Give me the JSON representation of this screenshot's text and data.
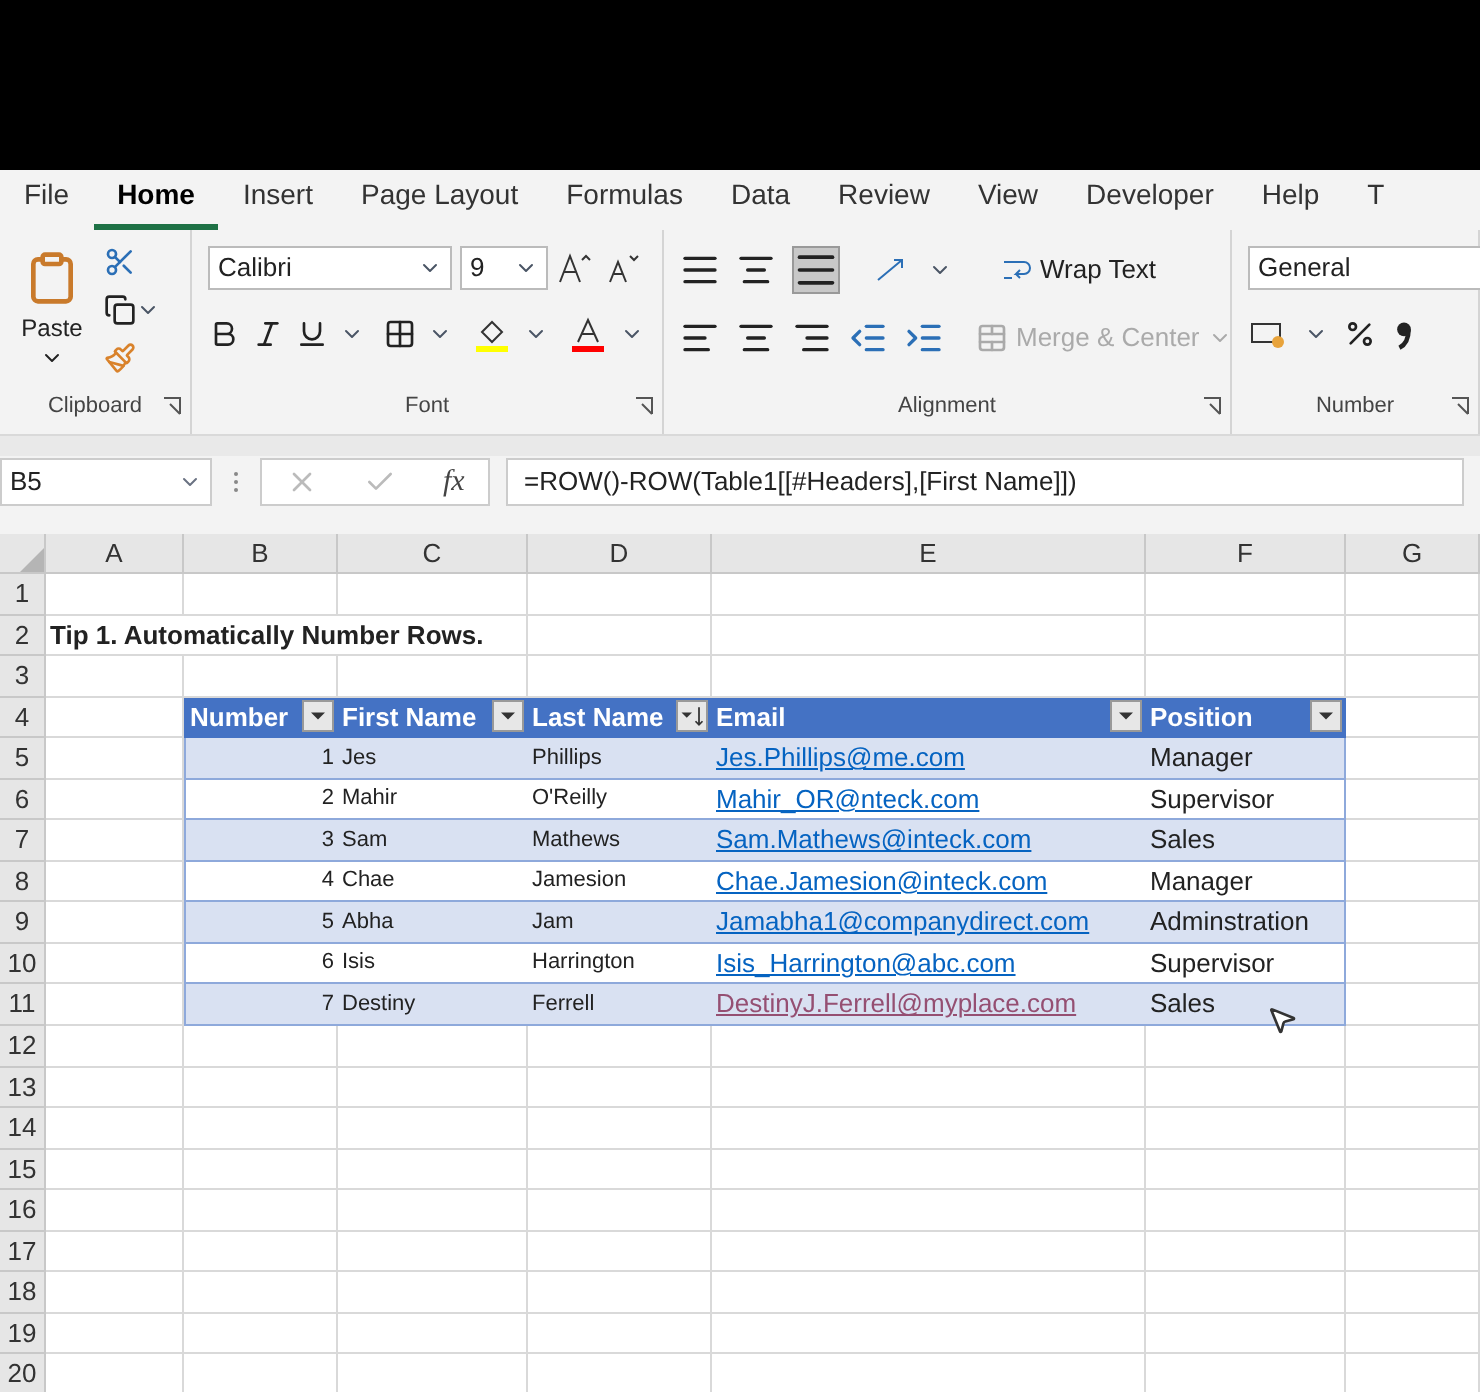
{
  "menu_tabs": [
    {
      "label": "File",
      "selected": false
    },
    {
      "label": "Home",
      "selected": true
    },
    {
      "label": "Insert",
      "selected": false
    },
    {
      "label": "Page Layout",
      "selected": false
    },
    {
      "label": "Formulas",
      "selected": false
    },
    {
      "label": "Data",
      "selected": false
    },
    {
      "label": "Review",
      "selected": false
    },
    {
      "label": "View",
      "selected": false
    },
    {
      "label": "Developer",
      "selected": false
    },
    {
      "label": "Help",
      "selected": false
    },
    {
      "label": "T",
      "selected": false
    }
  ],
  "ribbon": {
    "clipboard": {
      "paste": "Paste",
      "group_label": "Clipboard"
    },
    "font": {
      "font_name": "Calibri",
      "font_size": "9",
      "group_label": "Font"
    },
    "alignment": {
      "wrap_text": "Wrap Text",
      "merge_center": "Merge & Center",
      "merge_disabled": true,
      "group_label": "Alignment"
    },
    "number": {
      "format": "General",
      "group_label": "Number"
    }
  },
  "formula_bar": {
    "name_box": "B5",
    "function_label": "fx",
    "formula": "=ROW()-ROW(Table1[[#Headers],[First Name]])"
  },
  "sheet": {
    "columns": [
      "A",
      "B",
      "C",
      "D",
      "E",
      "F",
      "G"
    ],
    "row_numbers": [
      "1",
      "2",
      "3",
      "4",
      "5",
      "6",
      "7",
      "8",
      "9",
      "10",
      "11",
      "12",
      "13",
      "14",
      "15",
      "16",
      "17",
      "18",
      "19",
      "20"
    ],
    "title": "Tip 1.  Automatically Number Rows.",
    "table": {
      "headers": [
        {
          "label": "Number",
          "kind": "filter"
        },
        {
          "label": "First Name",
          "kind": "filter"
        },
        {
          "label": "Last Name",
          "kind": "sorted"
        },
        {
          "label": "Email",
          "kind": "filter"
        },
        {
          "label": "Position",
          "kind": "filter"
        }
      ],
      "rows": [
        {
          "number": "1",
          "first": "Jes",
          "last": "Phillips",
          "email": "Jes.Phillips@me.com",
          "visited": false,
          "position": "Manager"
        },
        {
          "number": "2",
          "first": "Mahir",
          "last": "O'Reilly",
          "email": "Mahir_OR@nteck.com",
          "visited": false,
          "position": "Supervisor"
        },
        {
          "number": "3",
          "first": "Sam",
          "last": "Mathews",
          "email": "Sam.Mathews@inteck.com",
          "visited": false,
          "position": "Sales"
        },
        {
          "number": "4",
          "first": "Chae",
          "last": "Jamesion",
          "email": "Chae.Jamesion@inteck.com",
          "visited": false,
          "position": "Manager"
        },
        {
          "number": "5",
          "first": "Abha",
          "last": "Jam",
          "email": "Jamabha1@companydirect.com",
          "visited": false,
          "position": "Adminstration"
        },
        {
          "number": "6",
          "first": "Isis",
          "last": "Harrington",
          "email": "Isis_Harrington@abc.com",
          "visited": false,
          "position": "Supervisor"
        },
        {
          "number": "7",
          "first": "Destiny",
          "last": "Ferrell",
          "email": "DestinyJ.Ferrell@myplace.com",
          "visited": true,
          "position": "Sales"
        }
      ]
    }
  }
}
